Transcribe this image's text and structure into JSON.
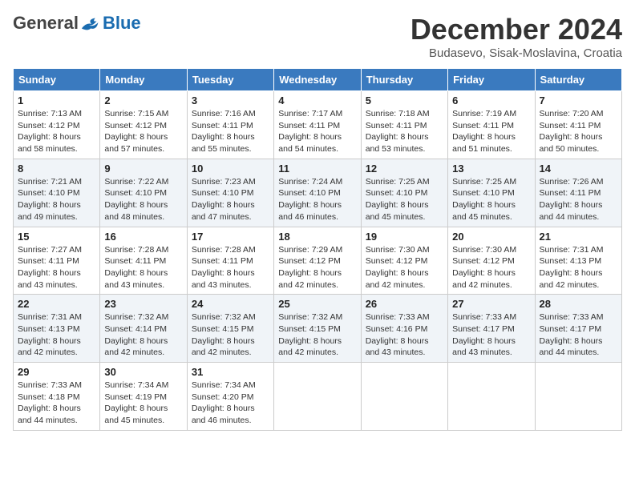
{
  "logo": {
    "general": "General",
    "blue": "Blue"
  },
  "header": {
    "month": "December 2024",
    "location": "Budasevo, Sisak-Moslavina, Croatia"
  },
  "weekdays": [
    "Sunday",
    "Monday",
    "Tuesday",
    "Wednesday",
    "Thursday",
    "Friday",
    "Saturday"
  ],
  "weeks": [
    [
      {
        "day": "1",
        "sunrise": "7:13 AM",
        "sunset": "4:12 PM",
        "daylight": "8 hours and 58 minutes."
      },
      {
        "day": "2",
        "sunrise": "7:15 AM",
        "sunset": "4:12 PM",
        "daylight": "8 hours and 57 minutes."
      },
      {
        "day": "3",
        "sunrise": "7:16 AM",
        "sunset": "4:11 PM",
        "daylight": "8 hours and 55 minutes."
      },
      {
        "day": "4",
        "sunrise": "7:17 AM",
        "sunset": "4:11 PM",
        "daylight": "8 hours and 54 minutes."
      },
      {
        "day": "5",
        "sunrise": "7:18 AM",
        "sunset": "4:11 PM",
        "daylight": "8 hours and 53 minutes."
      },
      {
        "day": "6",
        "sunrise": "7:19 AM",
        "sunset": "4:11 PM",
        "daylight": "8 hours and 51 minutes."
      },
      {
        "day": "7",
        "sunrise": "7:20 AM",
        "sunset": "4:11 PM",
        "daylight": "8 hours and 50 minutes."
      }
    ],
    [
      {
        "day": "8",
        "sunrise": "7:21 AM",
        "sunset": "4:10 PM",
        "daylight": "8 hours and 49 minutes."
      },
      {
        "day": "9",
        "sunrise": "7:22 AM",
        "sunset": "4:10 PM",
        "daylight": "8 hours and 48 minutes."
      },
      {
        "day": "10",
        "sunrise": "7:23 AM",
        "sunset": "4:10 PM",
        "daylight": "8 hours and 47 minutes."
      },
      {
        "day": "11",
        "sunrise": "7:24 AM",
        "sunset": "4:10 PM",
        "daylight": "8 hours and 46 minutes."
      },
      {
        "day": "12",
        "sunrise": "7:25 AM",
        "sunset": "4:10 PM",
        "daylight": "8 hours and 45 minutes."
      },
      {
        "day": "13",
        "sunrise": "7:25 AM",
        "sunset": "4:10 PM",
        "daylight": "8 hours and 45 minutes."
      },
      {
        "day": "14",
        "sunrise": "7:26 AM",
        "sunset": "4:11 PM",
        "daylight": "8 hours and 44 minutes."
      }
    ],
    [
      {
        "day": "15",
        "sunrise": "7:27 AM",
        "sunset": "4:11 PM",
        "daylight": "8 hours and 43 minutes."
      },
      {
        "day": "16",
        "sunrise": "7:28 AM",
        "sunset": "4:11 PM",
        "daylight": "8 hours and 43 minutes."
      },
      {
        "day": "17",
        "sunrise": "7:28 AM",
        "sunset": "4:11 PM",
        "daylight": "8 hours and 43 minutes."
      },
      {
        "day": "18",
        "sunrise": "7:29 AM",
        "sunset": "4:12 PM",
        "daylight": "8 hours and 42 minutes."
      },
      {
        "day": "19",
        "sunrise": "7:30 AM",
        "sunset": "4:12 PM",
        "daylight": "8 hours and 42 minutes."
      },
      {
        "day": "20",
        "sunrise": "7:30 AM",
        "sunset": "4:12 PM",
        "daylight": "8 hours and 42 minutes."
      },
      {
        "day": "21",
        "sunrise": "7:31 AM",
        "sunset": "4:13 PM",
        "daylight": "8 hours and 42 minutes."
      }
    ],
    [
      {
        "day": "22",
        "sunrise": "7:31 AM",
        "sunset": "4:13 PM",
        "daylight": "8 hours and 42 minutes."
      },
      {
        "day": "23",
        "sunrise": "7:32 AM",
        "sunset": "4:14 PM",
        "daylight": "8 hours and 42 minutes."
      },
      {
        "day": "24",
        "sunrise": "7:32 AM",
        "sunset": "4:15 PM",
        "daylight": "8 hours and 42 minutes."
      },
      {
        "day": "25",
        "sunrise": "7:32 AM",
        "sunset": "4:15 PM",
        "daylight": "8 hours and 42 minutes."
      },
      {
        "day": "26",
        "sunrise": "7:33 AM",
        "sunset": "4:16 PM",
        "daylight": "8 hours and 43 minutes."
      },
      {
        "day": "27",
        "sunrise": "7:33 AM",
        "sunset": "4:17 PM",
        "daylight": "8 hours and 43 minutes."
      },
      {
        "day": "28",
        "sunrise": "7:33 AM",
        "sunset": "4:17 PM",
        "daylight": "8 hours and 44 minutes."
      }
    ],
    [
      {
        "day": "29",
        "sunrise": "7:33 AM",
        "sunset": "4:18 PM",
        "daylight": "8 hours and 44 minutes."
      },
      {
        "day": "30",
        "sunrise": "7:34 AM",
        "sunset": "4:19 PM",
        "daylight": "8 hours and 45 minutes."
      },
      {
        "day": "31",
        "sunrise": "7:34 AM",
        "sunset": "4:20 PM",
        "daylight": "8 hours and 46 minutes."
      },
      null,
      null,
      null,
      null
    ]
  ],
  "labels": {
    "sunrise": "Sunrise:",
    "sunset": "Sunset:",
    "daylight": "Daylight:"
  }
}
